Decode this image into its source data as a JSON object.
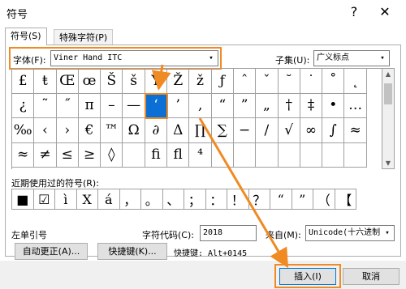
{
  "window": {
    "title": "符号",
    "help_glyph": "?",
    "close_glyph": "✕"
  },
  "tabs": [
    {
      "label": "符号(S)"
    },
    {
      "label": "特殊字符(P)"
    }
  ],
  "font": {
    "label": "字体(F):",
    "value": "Viner Hand ITC"
  },
  "subset": {
    "label": "子集(U):",
    "value": "广义标点"
  },
  "grid": [
    [
      "£",
      "ŧ",
      "Œ",
      "œ",
      "Š",
      "š",
      "Ÿ",
      "Ž",
      "ž",
      "ƒ",
      "ˆ",
      "ˇ",
      "˘",
      "˙",
      "˚",
      "˛"
    ],
    [
      "¿",
      "˜",
      "˝",
      "π",
      "–",
      "—",
      "‘",
      "’",
      "‚",
      "“",
      "”",
      "„",
      "†",
      "‡",
      "•",
      "…"
    ],
    [
      "‰",
      "‹",
      "›",
      "€",
      "™",
      "Ω",
      "∂",
      "Δ",
      "∏",
      "∑",
      "−",
      "∕",
      "√",
      "∞",
      "∫",
      "≈"
    ],
    [
      "≈",
      "≠",
      "≤",
      "≥",
      "◊",
      "",
      "fi",
      "fl",
      "⁴",
      "",
      "",
      "",
      "",
      "",
      "",
      ""
    ]
  ],
  "selected_cell_name": "left-single-quote",
  "recent": {
    "label": "近期使用过的符号(R):",
    "symbols": [
      "■",
      "☑",
      "ì",
      "X",
      "á",
      "，",
      "。",
      "、",
      "；",
      "：",
      "！",
      "？",
      "“",
      "”",
      "（",
      "【"
    ]
  },
  "char_name": "左单引号",
  "char_code": {
    "label": "字符代码(C):",
    "value": "2018"
  },
  "from": {
    "label": "来自(M):",
    "value": "Unicode(十六进制)"
  },
  "autocorrect_button": "自动更正(A)...",
  "shortcut_key_button": "快捷键(K)...",
  "shortcut_text": "快捷键: Alt+0145",
  "insert_button": "插入(I)",
  "cancel_button": "取消",
  "accent_color": "#f08a22",
  "selection_color": "#0b6fd6"
}
